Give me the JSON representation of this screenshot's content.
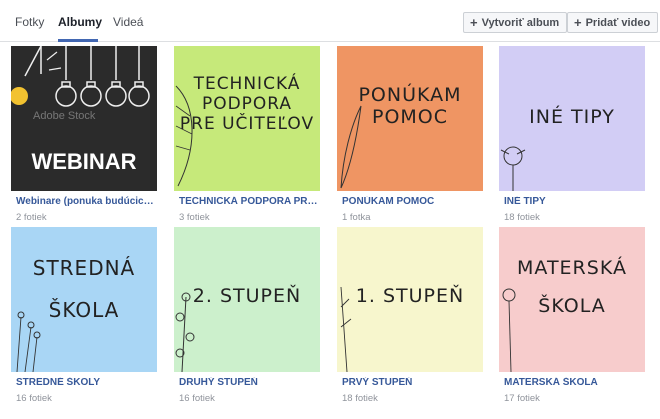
{
  "tabs": [
    {
      "label": "Fotky",
      "active": false
    },
    {
      "label": "Albumy",
      "active": true
    },
    {
      "label": "Videá",
      "active": false
    }
  ],
  "actions": {
    "create_album": "Vytvoriť album",
    "add_video": "Pridať video"
  },
  "albums": [
    {
      "title": "Webinare (ponuka budúcich webinarov)",
      "count": "2 fotiek",
      "thumb_lines": [
        "WEBINAR"
      ],
      "watermark": "Adobe Stock",
      "bg": "#2b2b2b"
    },
    {
      "title": "TECHNICKÁ PODPORA PRE UČITEĽOV",
      "count": "3 fotiek",
      "thumb_lines": [
        "TECHNICKÁ",
        "PODPORA",
        "PRE UČITEĽOV"
      ],
      "bg": "#c6e97a"
    },
    {
      "title": "PONÚKAM POMOC",
      "count": "1 fotka",
      "thumb_lines": [
        "PONÚKAM",
        "POMOC"
      ],
      "bg": "#ef9563"
    },
    {
      "title": "INÉ TIPY",
      "count": "18 fotiek",
      "thumb_lines": [
        "INÉ TIPY"
      ],
      "bg": "#d2cdf5"
    },
    {
      "title": "STREDNÉ ŠKOLY",
      "count": "16 fotiek",
      "thumb_lines": [
        "STREDNÁ",
        "ŠKOLA"
      ],
      "bg": "#a9d6f5"
    },
    {
      "title": "DRUHÝ STUPEŇ",
      "count": "16 fotiek",
      "thumb_lines": [
        "2. STUPEŇ"
      ],
      "bg": "#ccf0cc"
    },
    {
      "title": "PRVÝ STUPEŇ",
      "count": "18 fotiek",
      "thumb_lines": [
        "1. STUPEŇ"
      ],
      "bg": "#f7f6cd"
    },
    {
      "title": "MATERSKÁ ŠKOLA",
      "count": "17 fotiek",
      "thumb_lines": [
        "MATERSKÁ",
        "ŠKOLA"
      ],
      "bg": "#f7cccc"
    }
  ]
}
